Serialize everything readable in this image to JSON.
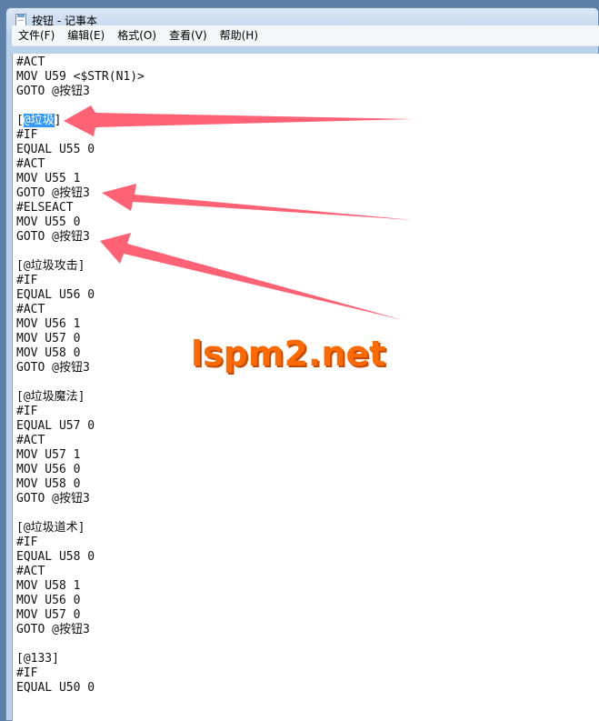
{
  "window": {
    "title": "按钮 - 记事本"
  },
  "menubar": {
    "items": [
      "文件(F)",
      "编辑(E)",
      "格式(O)",
      "查看(V)",
      "帮助(H)"
    ]
  },
  "editor": {
    "lines": [
      "#ACT",
      "MOV U59 <$STR(N1)>",
      "GOTO @按钮3",
      "",
      "[@垃圾]",
      "#IF",
      "EQUAL U55 0",
      "#ACT",
      "MOV U55 1",
      "GOTO @按钮3",
      "#ELSEACT",
      "MOV U55 0",
      "GOTO @按钮3",
      "",
      "[@垃圾攻击]",
      "#IF",
      "EQUAL U56 0",
      "#ACT",
      "MOV U56 1",
      "MOV U57 0",
      "MOV U58 0",
      "GOTO @按钮3",
      "",
      "[@垃圾魔法]",
      "#IF",
      "EQUAL U57 0",
      "#ACT",
      "MOV U57 1",
      "MOV U56 0",
      "MOV U58 0",
      "GOTO @按钮3",
      "",
      "[@垃圾道术]",
      "#IF",
      "EQUAL U58 0",
      "#ACT",
      "MOV U58 1",
      "MOV U56 0",
      "MOV U57 0",
      "GOTO @按钮3",
      "",
      "[@133]",
      "#IF",
      "EQUAL U50 0"
    ],
    "selection": {
      "line": 4,
      "text": "@垃圾",
      "before": "[",
      "after": "]"
    }
  },
  "watermark": {
    "text": "lspm2.net",
    "color": "#ff6a00"
  },
  "colors": {
    "arrow": "#ff5a6e",
    "selection": "#3399ff"
  }
}
